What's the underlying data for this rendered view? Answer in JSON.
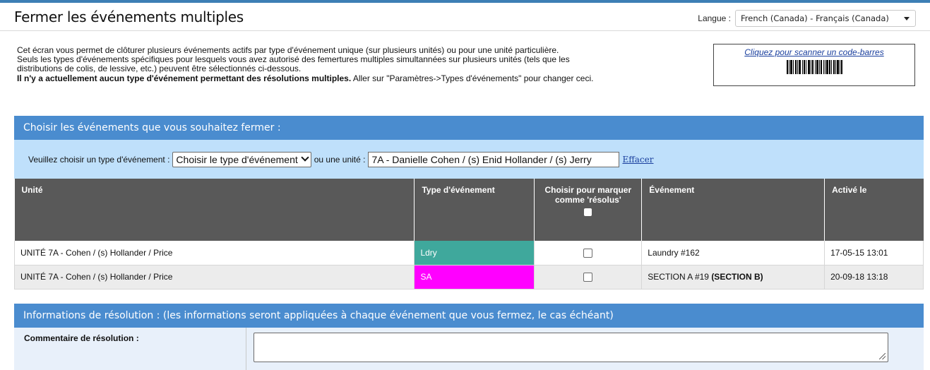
{
  "header": {
    "title": "Fermer les événements multiples",
    "language_label": "Langue :",
    "language_value": "French (Canada) - Français (Canada)"
  },
  "intro": {
    "line1": "Cet écran vous permet de clôturer plusieurs événements actifs par type d'événement unique (sur plusieurs unités) ou pour une unité particulière.",
    "line2": "Seuls les types d'événements spécifiques pour lesquels vous avez autorisé des femertures multiples simultannées sur plusieurs unités (tels que les distributions de colis, de lessive, etc.) peuvent être sélectionnés ci-dessous.",
    "bold_notice": "Il n'y a actuellement aucun type d'événement permettant des résolutions multiples.",
    "notice_tail": " Aller sur \"Paramètres->Types d'événements\" pour changer ceci."
  },
  "barcode": {
    "link_text": "Cliquez pour scanner un code-barres"
  },
  "choose_section": {
    "title": "Choisir les événements que vous souhaitez fermer :",
    "type_label": "Veuillez choisir un type d'événement :",
    "type_select_value": "Choisir le type d'événement",
    "or_unit_label": "ou une unité :",
    "unit_value": "7A - Danielle Cohen / (s) Enid Hollander / (s) Jerry",
    "clear_label": "Effacer"
  },
  "table": {
    "headers": {
      "unit": "Unité",
      "event_type": "Type d'événement",
      "choose_resolved": "Choisir pour marquer comme 'résolus'",
      "event": "Événement",
      "activated": "Activé le"
    },
    "rows": [
      {
        "unit": "UNITÉ 7A - Cohen / (s) Hollander / Price",
        "type": "Ldry",
        "type_color": "#3fa89c",
        "event": "Laundry #162",
        "event_extra": "",
        "activated": "17-05-15 13:01",
        "checked": false
      },
      {
        "unit": "UNITÉ 7A - Cohen / (s) Hollander / Price",
        "type": "SA",
        "type_color": "#ff00ff",
        "event": "SECTION A #19 ",
        "event_extra": "(SECTION B)",
        "activated": "20-09-18 13:18",
        "checked": false
      }
    ]
  },
  "resolution": {
    "title": "Informations de résolution : (les informations seront appliquées à chaque événement que vous fermez, le cas échéant)",
    "comment_label": "Commentaire de résolution :",
    "comment_value": ""
  },
  "colors": {
    "section_bar": "#4a8ccf",
    "filter_row": "#bfe0fb",
    "table_header": "#595959"
  }
}
